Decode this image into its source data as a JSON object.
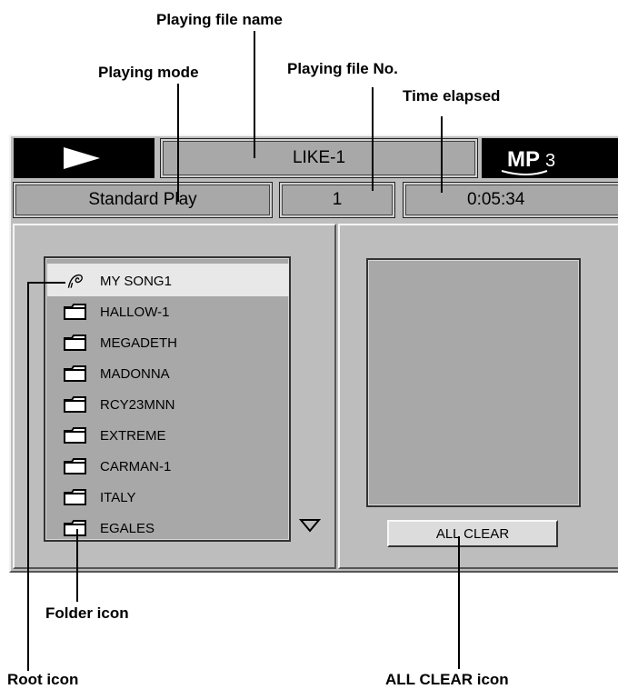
{
  "callouts": {
    "playing_file_name": "Playing file name",
    "playing_mode": "Playing mode",
    "playing_file_no": "Playing file No.",
    "time_elapsed": "Time elapsed",
    "folder_icon": "Folder icon",
    "root_icon": "Root icon",
    "all_clear_icon": "ALL CLEAR icon"
  },
  "header": {
    "file_name": "LIKE-1",
    "mp3_logo": "MP3",
    "mode": "Standard Play",
    "file_no": "1",
    "time": "0:05:34"
  },
  "file_list": {
    "items": [
      {
        "label": "MY SONG1",
        "icon": "root-icon",
        "selected": true
      },
      {
        "label": "HALLOW-1",
        "icon": "folder-icon"
      },
      {
        "label": "MEGADETH",
        "icon": "folder-icon"
      },
      {
        "label": "MADONNA",
        "icon": "folder-icon"
      },
      {
        "label": "RCY23MNN",
        "icon": "folder-icon"
      },
      {
        "label": "EXTREME",
        "icon": "folder-icon"
      },
      {
        "label": "CARMAN-1",
        "icon": "folder-icon"
      },
      {
        "label": "ITALY",
        "icon": "folder-icon"
      },
      {
        "label": "EGALES",
        "icon": "folder-icon"
      }
    ],
    "scroll_icon": "triangle-down-icon"
  },
  "program_panel": {
    "all_clear_label": "ALL CLEAR"
  }
}
